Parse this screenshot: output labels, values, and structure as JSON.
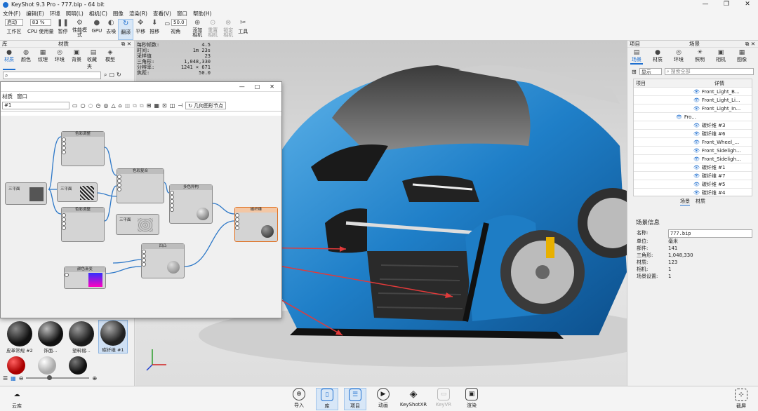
{
  "titlebar": {
    "title": "KeyShot 9.3 Pro  - 777.bip  - 64 bit",
    "minimize": "—",
    "maximize": "❐",
    "close": "✕"
  },
  "menubar": [
    "文件(F)",
    "编辑(E)",
    "环境",
    "照明(L)",
    "相机(C)",
    "图像",
    "渲染(R)",
    "查看(V)",
    "窗口",
    "帮助(H)"
  ],
  "toolbar": {
    "workspace_select": "启动",
    "workspace": "工作区",
    "cpu_select": "83 %",
    "cpu": "CPU 使用量",
    "pause": "暂停",
    "perf": "性能模式",
    "gpu": "GPU",
    "denoise": "去噪",
    "tumble": "翻滚",
    "pan": "平移",
    "dolly": "推移",
    "fov_value": "50.0",
    "view": "视角",
    "add_camera": "添加相机",
    "reset_camera": "重置相机",
    "lock_camera": "锁定相机",
    "tools": "工具"
  },
  "left_panel": {
    "lib_title": "库",
    "mat_title": "材质",
    "tabs": [
      "材质",
      "颜色",
      "纹理",
      "环境",
      "背景",
      "收藏夹",
      "模型"
    ],
    "thumbnails": [
      {
        "label": "皮革常规 #2",
        "color": "#111"
      },
      {
        "label": "饰面...",
        "color": "#222"
      },
      {
        "label": "塑料褶...",
        "color": "#2a2a2a"
      },
      {
        "label": "碳纤维 #1",
        "color": "#333"
      }
    ],
    "thumbnails_row2": [
      {
        "color": "#c81010"
      },
      {
        "color": "#ddd"
      },
      {
        "color": "#151515"
      }
    ]
  },
  "stats": [
    {
      "k": "每秒帧数:",
      "v": "4.5"
    },
    {
      "k": "时间:",
      "v": "1m 23s"
    },
    {
      "k": "采样值",
      "v": "23"
    },
    {
      "k": "三角形:",
      "v": "1,048,330"
    },
    {
      "k": "分辨率:",
      "v": "1241 × 671"
    },
    {
      "k": "焦距:",
      "v": "50.0"
    }
  ],
  "matwin": {
    "menu": [
      "材质",
      "窗口"
    ],
    "name": "#1",
    "geo_node_btn": "几何图形节点",
    "min": "—",
    "max": "□",
    "close": "✕",
    "nodes": {
      "tex_a": "三平面",
      "tex_b": "三平面",
      "tex_c": "三平面",
      "cc1": "色彩调整",
      "cc2": "色彩调整",
      "cc3": "色彩复合",
      "multi": "多色异构",
      "bump": "凹凸",
      "out": "碳纤维",
      "grad": "颜色渐变"
    }
  },
  "right_panel": {
    "proj_title": "项目",
    "scene_title": "场景",
    "tabs": [
      "场景",
      "材质",
      "环境",
      "照明",
      "相机",
      "图像"
    ],
    "filter": "显示",
    "search_placeholder": "搜索全部",
    "col_item": "项目",
    "col_detail": "详情",
    "tree": [
      "Front_Light_B...",
      "Front_Light_Li...",
      "Front_Light_In...",
      "Fro...",
      "碳纤维 #3",
      "碳纤维 #6",
      "Front_Wheel_...",
      "Front_Sideligh...",
      "Front_Sideligh...",
      "碳纤维 #1",
      "碳纤维 #7",
      "碳纤维 #5",
      "碳纤维 #4"
    ],
    "subtabs": [
      "场景",
      "材质"
    ],
    "info_title": "场景信息",
    "info": [
      {
        "k": "名称:",
        "v": "777.bip"
      },
      {
        "k": "单位:",
        "v": "毫米"
      },
      {
        "k": "部件:",
        "v": "141"
      },
      {
        "k": "三角形:",
        "v": "1,048,330"
      },
      {
        "k": "材质:",
        "v": "123"
      },
      {
        "k": "相机:",
        "v": "1"
      },
      {
        "k": "场景设置:",
        "v": "1"
      }
    ]
  },
  "bottom": {
    "cloud": "云库",
    "import": "导入",
    "library": "库",
    "project": "项目",
    "animation": "动画",
    "keyshotxr": "KeyShotXR",
    "keyvr": "KeyVR",
    "render": "渲染",
    "screenshot": "截屏"
  }
}
